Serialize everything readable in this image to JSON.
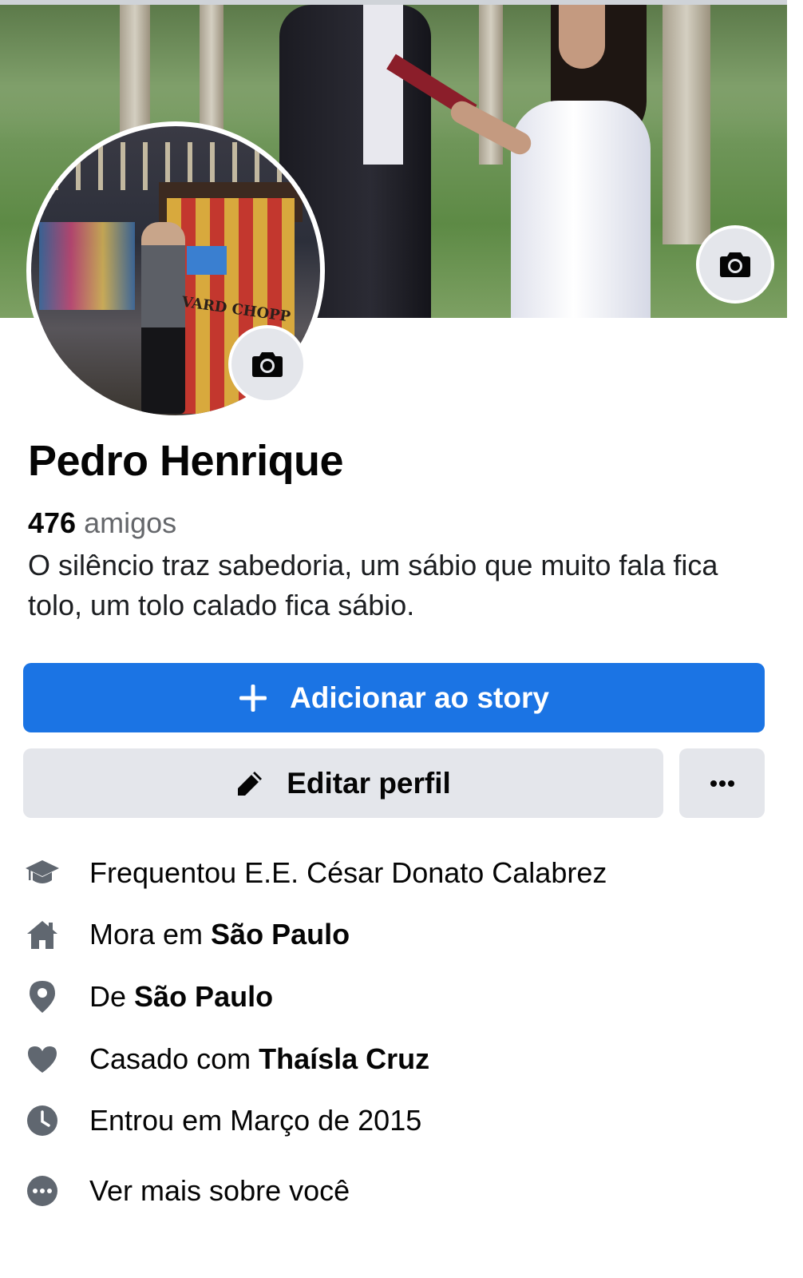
{
  "profile": {
    "name": "Pedro Henrique",
    "friends_count": "476",
    "friends_label": "amigos",
    "bio": "O silêncio traz sabedoria, um sábio que muito fala fica tolo, um tolo calado fica sábio.",
    "avatar_sign_text": "VARD CHOPP"
  },
  "actions": {
    "add_story_label": "Adicionar ao story",
    "edit_profile_label": "Editar perfil",
    "more_label": "..."
  },
  "details": {
    "education": {
      "text": "Frequentou E.E. César Donato Calabrez",
      "icon": "graduation-cap-icon"
    },
    "lives": {
      "prefix": "Mora em ",
      "place": "São Paulo",
      "icon": "home-icon"
    },
    "from": {
      "prefix": "De ",
      "place": "São Paulo",
      "icon": "location-pin-icon"
    },
    "relationship": {
      "prefix": "Casado com ",
      "partner": "Thaísla Cruz",
      "icon": "heart-icon"
    },
    "joined": {
      "text": "Entrou em Março de 2015",
      "icon": "clock-icon"
    },
    "see_more": {
      "text": "Ver mais sobre você",
      "icon": "more-dots-icon"
    }
  },
  "colors": {
    "primary": "#1b74e4",
    "secondary_button": "#e4e6eb",
    "muted_text": "#65676b",
    "icon_gray": "#606770"
  }
}
